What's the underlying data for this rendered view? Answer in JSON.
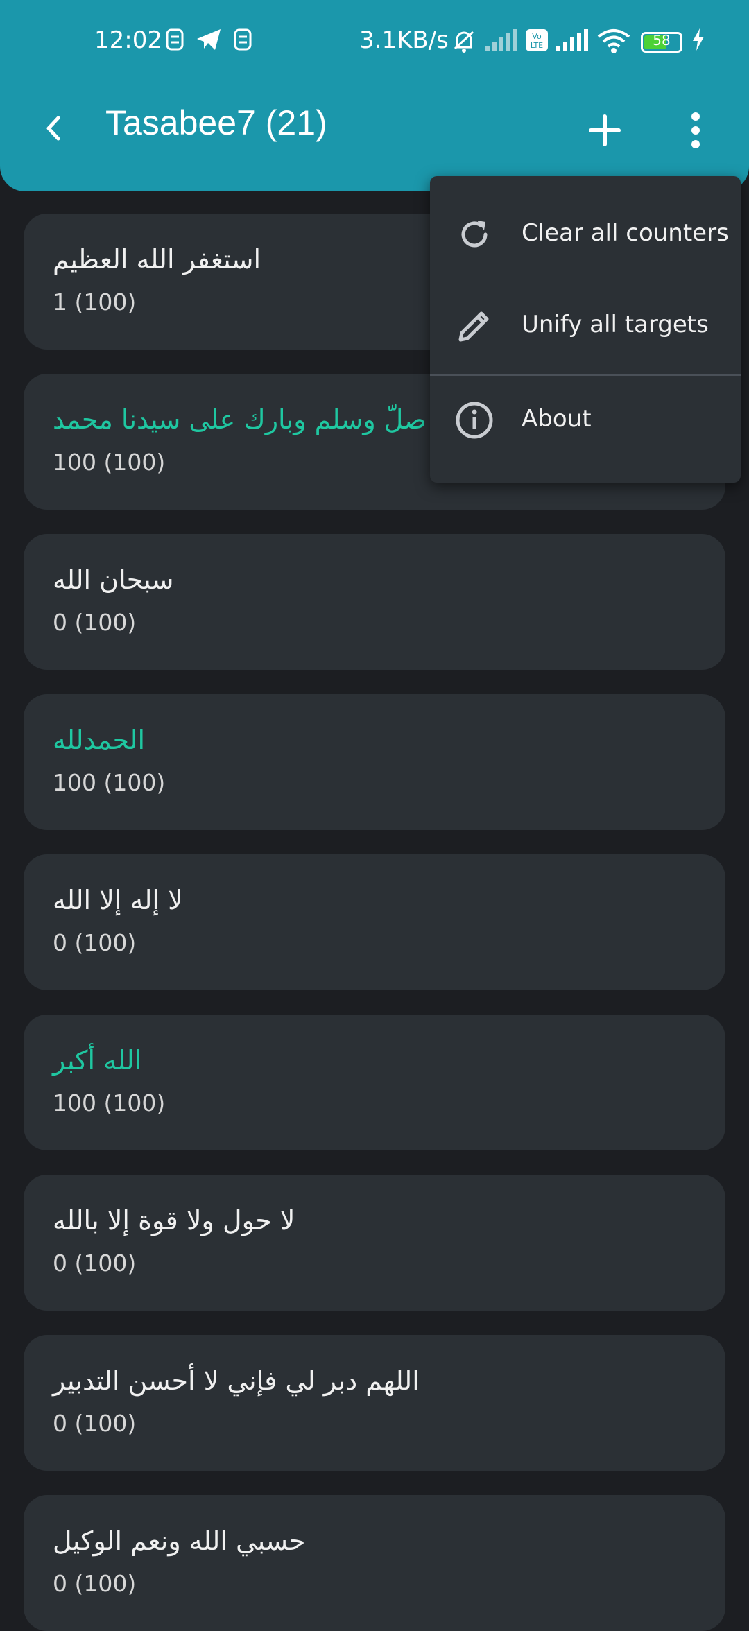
{
  "status_bar": {
    "time": "12:02",
    "net_speed": "3.1KB/s",
    "battery_level": "58"
  },
  "toolbar": {
    "title": "Tasabee7 (21)"
  },
  "menu": {
    "items": [
      {
        "label": "Clear all counters",
        "icon": "refresh-icon"
      },
      {
        "label": "Unify all targets",
        "icon": "pencil-icon"
      },
      {
        "label": "About",
        "icon": "info-icon"
      }
    ]
  },
  "tasbeeh_list": [
    {
      "text": "استغفر الله العظيم",
      "count": "1 (100)",
      "completed": false
    },
    {
      "text": "اللهم صلّ وسلم وبارك على سيدنا محمد",
      "count": "100 (100)",
      "completed": true
    },
    {
      "text": "سبحان الله",
      "count": "0 (100)",
      "completed": false
    },
    {
      "text": "الحمدلله",
      "count": "100 (100)",
      "completed": true
    },
    {
      "text": "لا إله إلا الله",
      "count": "0 (100)",
      "completed": false
    },
    {
      "text": "الله أكبر",
      "count": "100 (100)",
      "completed": true
    },
    {
      "text": "لا حول ولا قوة إلا بالله",
      "count": "0 (100)",
      "completed": false
    },
    {
      "text": "اللهم دبر لي فإني لا أحسن التدبير",
      "count": "0 (100)",
      "completed": false
    },
    {
      "text": "حسبي الله ونعم الوكيل",
      "count": "0 (100)",
      "completed": false
    }
  ],
  "colors": {
    "app_bar": "#1b97ab",
    "background": "#1c1e22",
    "card": "#2b3035",
    "completed_text": "#1fc7a1"
  }
}
